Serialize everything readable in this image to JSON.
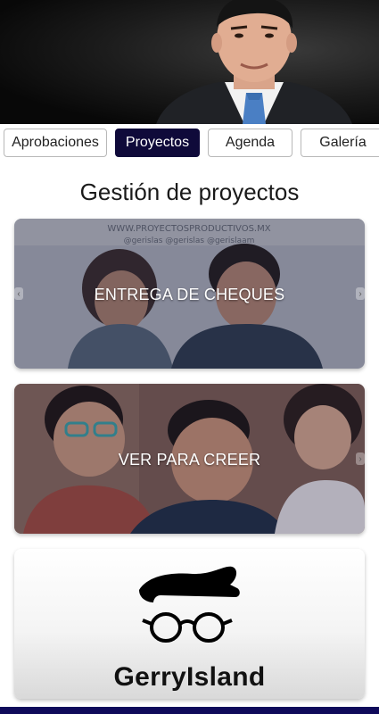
{
  "tabs": [
    {
      "label": "Aprobaciones",
      "active": false
    },
    {
      "label": "Proyectos",
      "active": true
    },
    {
      "label": "Agenda",
      "active": false
    },
    {
      "label": "Galería",
      "active": false
    }
  ],
  "page": {
    "title": "Gestión de proyectos"
  },
  "cards": [
    {
      "label": "ENTREGA DE CHEQUES",
      "banner_text": "WWW.PROYECTOSPRODUCTIVOS.MX",
      "handle_text": "@gerislas   @gerislas   @gerislaam"
    },
    {
      "label": "VER PARA CREER"
    }
  ],
  "brand": {
    "name": "GerryIsland"
  },
  "colors": {
    "active_tab": "#0f0a3a",
    "bottom_bar": "#0f0a5a"
  }
}
